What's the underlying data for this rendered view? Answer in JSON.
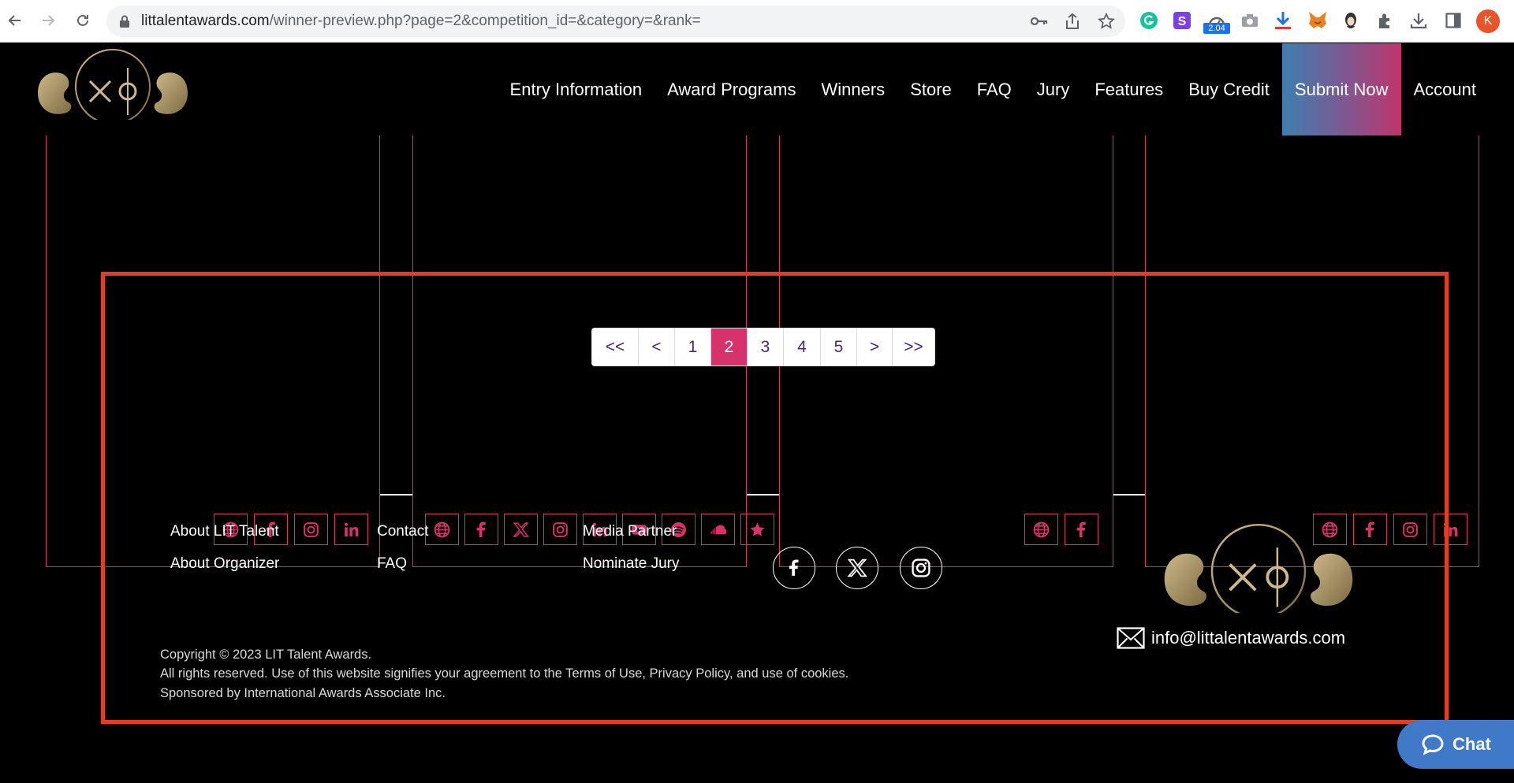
{
  "browser": {
    "url_host": "littalentawards.com",
    "url_path": "/winner-preview.php?page=2&competition_id=&category=&rank=",
    "extension_badge": "2.04",
    "profile_initial": "K"
  },
  "header": {
    "nav": [
      {
        "label": "Entry Information"
      },
      {
        "label": "Award Programs"
      },
      {
        "label": "Winners"
      },
      {
        "label": "Store"
      },
      {
        "label": "FAQ"
      },
      {
        "label": "Jury"
      },
      {
        "label": "Features"
      },
      {
        "label": "Buy Credit"
      },
      {
        "label": "Submit Now"
      },
      {
        "label": "Account"
      }
    ]
  },
  "pagination": {
    "first": "<<",
    "prev": "<",
    "pages": [
      "1",
      "2",
      "3",
      "4",
      "5"
    ],
    "current": "2",
    "next": ">",
    "last": ">>"
  },
  "footer": {
    "links_col1": [
      "About LIT Talent",
      "About Organizer"
    ],
    "links_col2": [
      "Contact",
      "FAQ"
    ],
    "links_col3": [
      "Media Partner",
      "Nominate Jury"
    ],
    "email": "info@littalentawards.com",
    "copyright": "Copyright © 2023 LIT Talent Awards.",
    "rights": "All rights reserved. Use of this website signifies your agreement to the Terms of Use, Privacy Policy, and use of cookies.",
    "sponsor": "Sponsored by International Awards Associate Inc."
  },
  "chat": {
    "label": "Chat"
  },
  "colors": {
    "accent": "#d6336c",
    "pager_text": "#4a2a74",
    "highlight": "#e53b28",
    "chat": "#3f79c8",
    "gold": "#b8a070"
  }
}
